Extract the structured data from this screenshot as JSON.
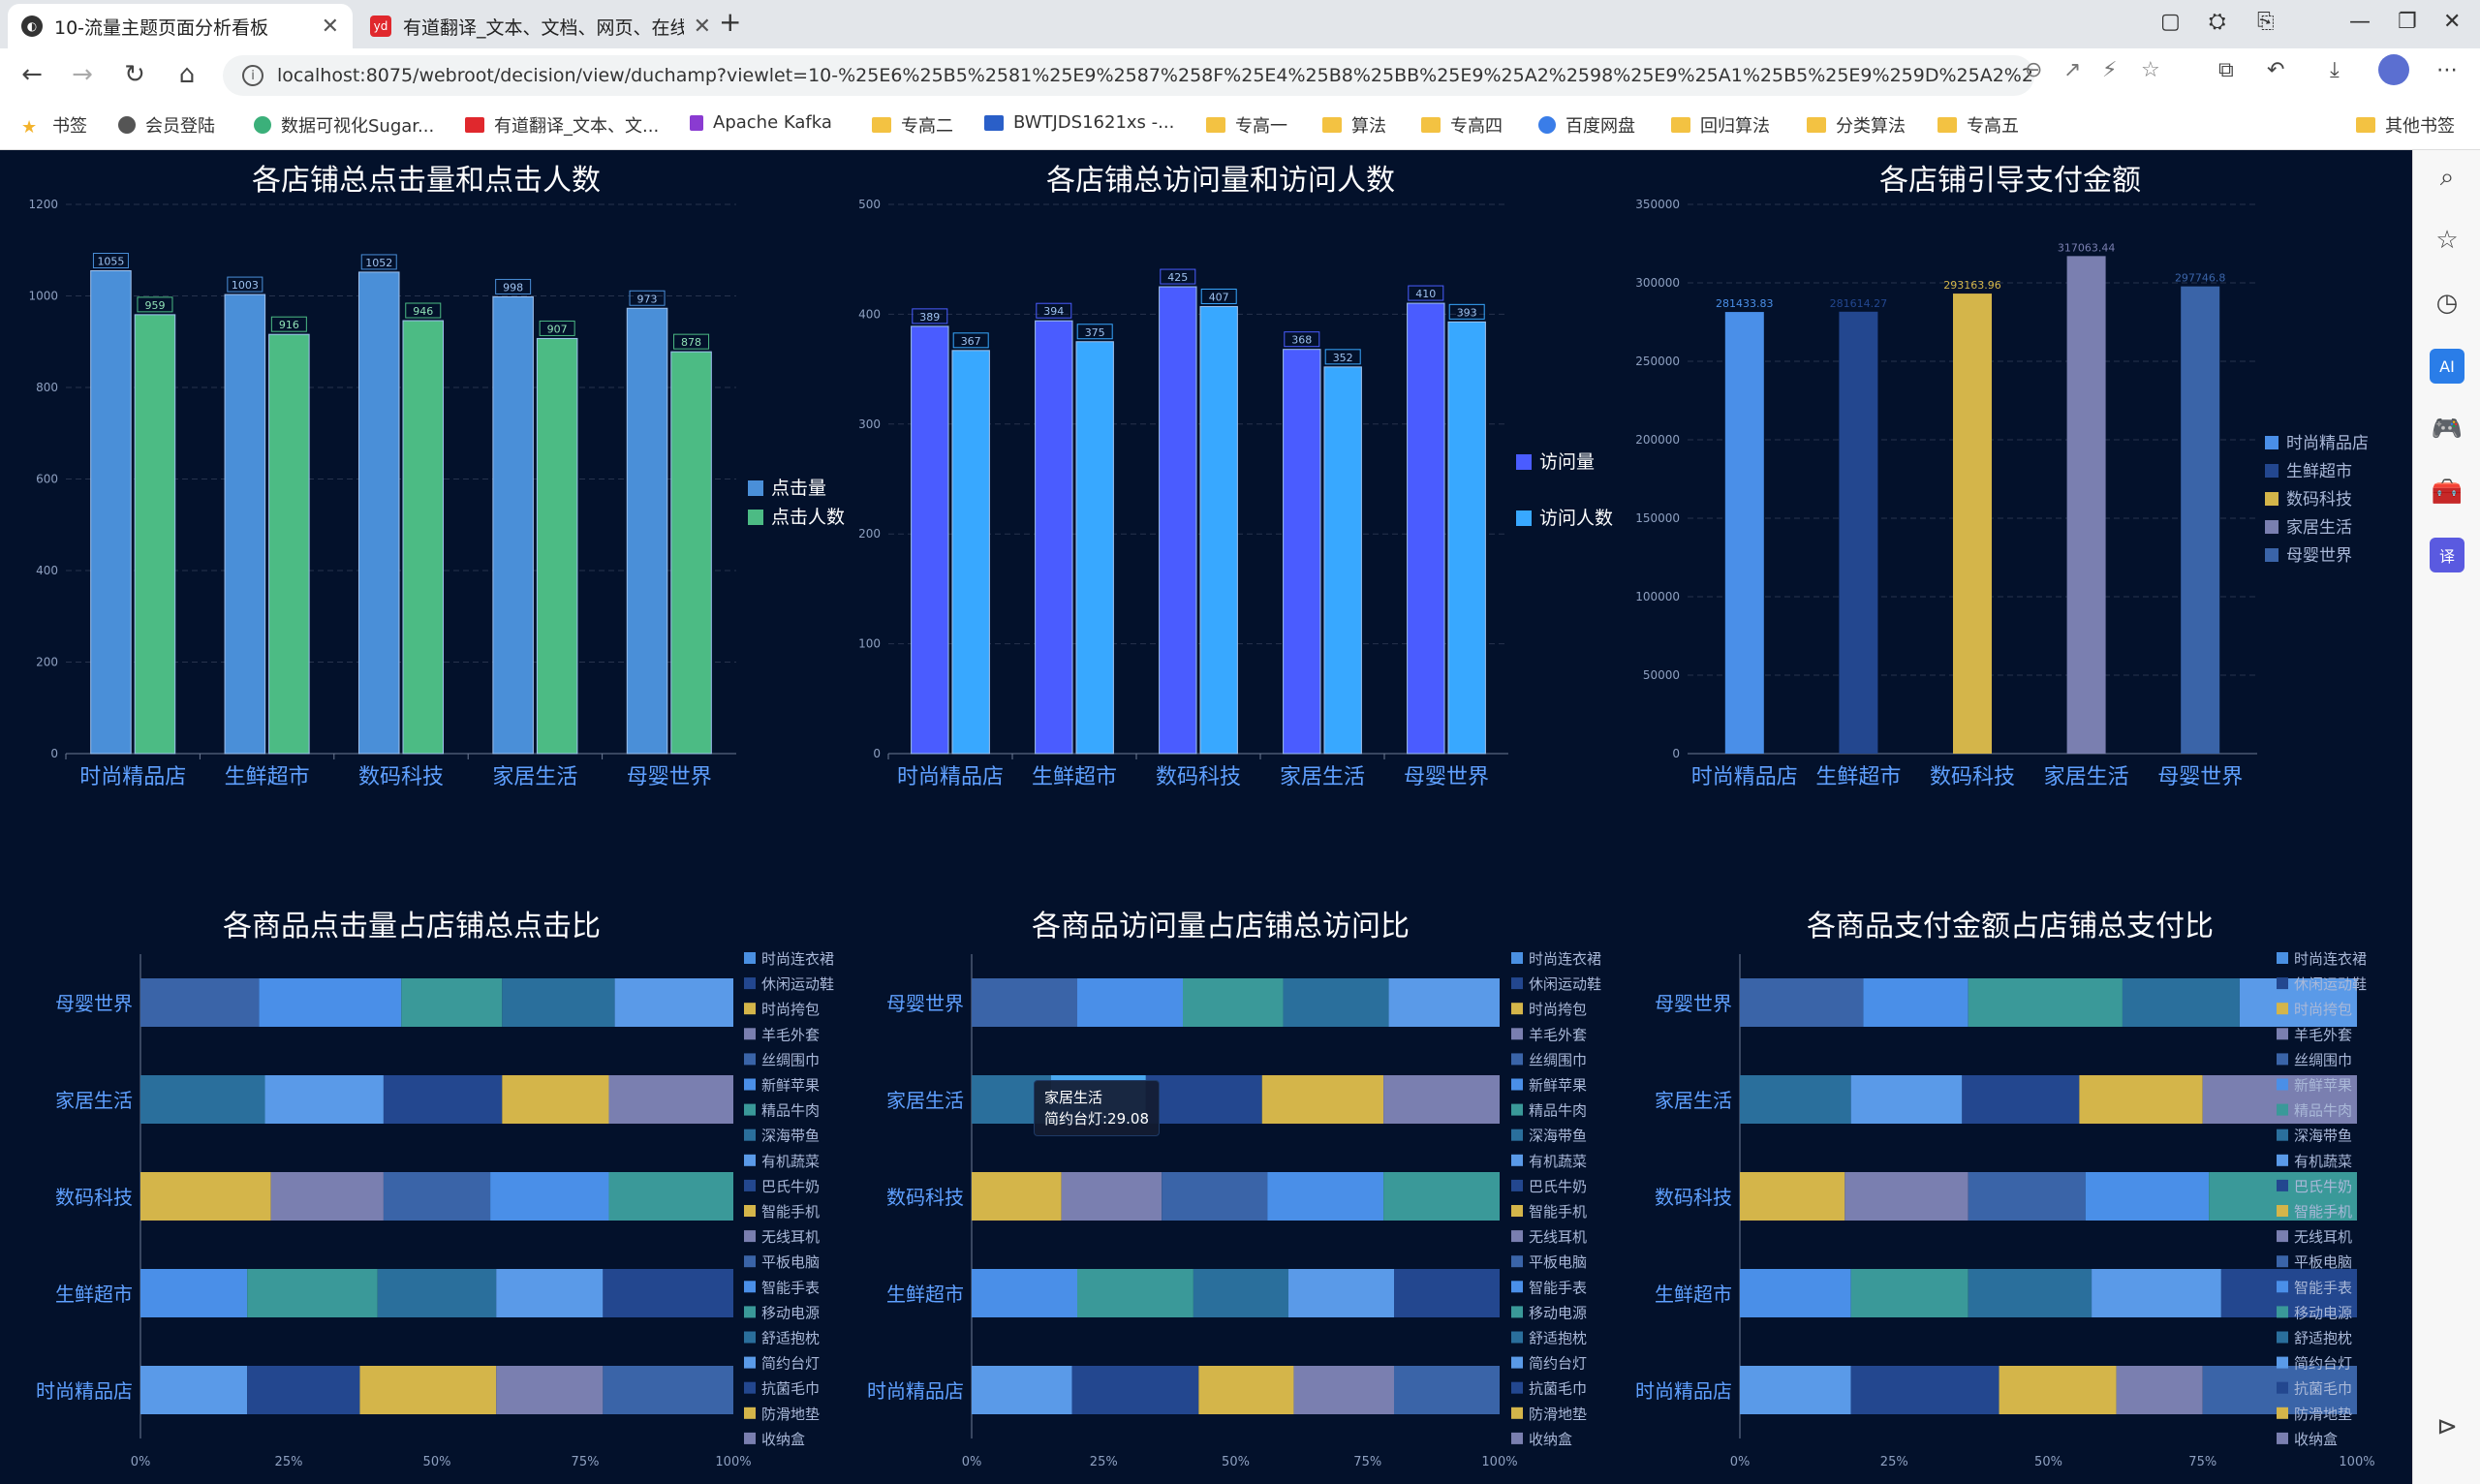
{
  "browser": {
    "tabs": [
      {
        "title": "10-流量主题页面分析看板",
        "close": "✕",
        "active": true
      },
      {
        "title": "有道翻译_文本、文档、网页、在线...",
        "close": "✕",
        "active": false
      }
    ],
    "new_tab": "+",
    "url": "localhost:8075/webroot/decision/view/duchamp?viewlet=10-%25E6%25B5%2581%25E9%2587%258F%25E4%25B8%25BB%25E9%25A2%2598%25E9%25A1%25B5%25E9%259D%25A2%25E5%2588%2586%...",
    "bookmarks": [
      "书签",
      "会员登陆",
      "数据可视化Sugar...",
      "有道翻译_文本、文...",
      "Apache Kafka",
      "专高二",
      "BWTJDS1621xs -...",
      "专高一",
      "算法",
      "专高四",
      "百度网盘",
      "回归算法",
      "分类算法",
      "专高五"
    ],
    "other_bookmarks": "其他书签"
  },
  "colors": {
    "bg": "#03112b",
    "click": "#4a8fd8",
    "clickers": "#4cbb84",
    "visits": "#4a5cff",
    "visitors": "#38a8ff",
    "gridline": "#27334d",
    "axis_text": "#8ea0c0",
    "label_text": "#5fa0ff"
  },
  "charts": {
    "clicks": {
      "title": "各店铺总点击量和点击人数",
      "categories": [
        "时尚精品店",
        "生鲜超市",
        "数码科技",
        "家居生活",
        "母婴世界"
      ],
      "series": [
        {
          "name": "点击量",
          "values": [
            1055,
            1003,
            1052,
            998,
            973
          ]
        },
        {
          "name": "点击人数",
          "values": [
            959,
            916,
            946,
            907,
            878
          ]
        }
      ],
      "ylim": [
        0,
        1200
      ],
      "yticks": [
        0,
        200,
        400,
        600,
        800,
        1000,
        1200
      ]
    },
    "visits": {
      "title": "各店铺总访问量和访问人数",
      "categories": [
        "时尚精品店",
        "生鲜超市",
        "数码科技",
        "家居生活",
        "母婴世界"
      ],
      "series": [
        {
          "name": "访问量",
          "values": [
            389,
            394,
            425,
            368,
            410
          ]
        },
        {
          "name": "访问人数",
          "values": [
            367,
            375,
            407,
            352,
            393
          ]
        }
      ],
      "ylim": [
        0,
        500
      ],
      "yticks": [
        0,
        100,
        200,
        300,
        400,
        500
      ]
    },
    "payment": {
      "title": "各店铺引导支付金额",
      "categories": [
        "时尚精品店",
        "生鲜超市",
        "数码科技",
        "家居生活",
        "母婴世界"
      ],
      "values": [
        281433.83,
        281614.27,
        293163.96,
        317063.44,
        297746.8
      ],
      "value_labels": [
        "281433.83",
        "281614.27",
        "293163.96",
        "317063.44",
        "297746.8"
      ],
      "bar_colors": [
        "#4a8fe8",
        "#23478f",
        "#d4b54a",
        "#7a7fb0",
        "#3a64a8"
      ],
      "ylim": [
        0,
        350000
      ],
      "yticks": [
        0,
        50000,
        100000,
        150000,
        200000,
        250000,
        300000,
        350000
      ],
      "legend": [
        "时尚精品店",
        "生鲜超市",
        "数码科技",
        "家居生活",
        "母婴世界"
      ]
    },
    "stack_legend": [
      "时尚连衣裙",
      "休闲运动鞋",
      "时尚挎包",
      "羊毛外套",
      "丝绸围巾",
      "新鲜苹果",
      "精品牛肉",
      "深海带鱼",
      "有机蔬菜",
      "巴氏牛奶",
      "智能手机",
      "无线耳机",
      "平板电脑",
      "智能手表",
      "移动电源",
      "舒适抱枕",
      "简约台灯",
      "抗菌毛巾",
      "防滑地垫",
      "收纳盒"
    ],
    "stack_legend_colors": [
      "#4a90e2",
      "#23478f",
      "#d4b54a",
      "#7a7fb0",
      "#3a64a8",
      "#4a8fe8",
      "#3a9999",
      "#2a6f9c",
      "#5a9ae8",
      "#23478f",
      "#d4b54a",
      "#7a7fb0",
      "#3a64a8",
      "#4a8fe8",
      "#3a9999",
      "#2a6f9c",
      "#5a9ae8",
      "#23478f",
      "#d4b54a",
      "#7a7fb0"
    ],
    "stacks": [
      {
        "title": "各商品点击量占店铺总点击比",
        "rows": [
          {
            "store": "母婴世界",
            "parts": [
              20,
              24,
              17,
              19,
              20
            ],
            "colors": [
              "#3a64a8",
              "#4a8fe8",
              "#3a9999",
              "#2a6f9c",
              "#5a9ae8"
            ]
          },
          {
            "store": "家居生活",
            "parts": [
              21,
              20,
              20,
              18,
              21
            ],
            "colors": [
              "#2a6f9c",
              "#5a9ae8",
              "#23478f",
              "#d4b54a",
              "#7a7fb0"
            ]
          },
          {
            "store": "数码科技",
            "parts": [
              22,
              19,
              18,
              20,
              21
            ],
            "colors": [
              "#d4b54a",
              "#7a7fb0",
              "#3a64a8",
              "#4a8fe8",
              "#3a9999"
            ]
          },
          {
            "store": "生鲜超市",
            "parts": [
              18,
              22,
              20,
              18,
              22
            ],
            "colors": [
              "#4a8fe8",
              "#3a9999",
              "#2a6f9c",
              "#5a9ae8",
              "#23478f"
            ]
          },
          {
            "store": "时尚精品店",
            "parts": [
              18,
              19,
              23,
              18,
              22
            ],
            "colors": [
              "#5a9ae8",
              "#23478f",
              "#d4b54a",
              "#7a7fb0",
              "#3a64a8"
            ]
          }
        ]
      },
      {
        "title": "各商品访问量占店铺总访问比",
        "rows": [
          {
            "store": "母婴世界",
            "parts": [
              20,
              20,
              19,
              20,
              21
            ],
            "colors": [
              "#3a64a8",
              "#4a8fe8",
              "#3a9999",
              "#2a6f9c",
              "#5a9ae8"
            ]
          },
          {
            "store": "家居生活",
            "parts": [
              15,
              18,
              22,
              23,
              22
            ],
            "colors": [
              "#2a6f9c",
              "#4aa8f0",
              "#23478f",
              "#d4b54a",
              "#7a7fb0"
            ]
          },
          {
            "store": "数码科技",
            "parts": [
              17,
              19,
              20,
              22,
              22
            ],
            "colors": [
              "#d4b54a",
              "#7a7fb0",
              "#3a64a8",
              "#4a8fe8",
              "#3a9999"
            ]
          },
          {
            "store": "生鲜超市",
            "parts": [
              20,
              22,
              18,
              20,
              20
            ],
            "colors": [
              "#4a8fe8",
              "#3a9999",
              "#2a6f9c",
              "#5a9ae8",
              "#23478f"
            ]
          },
          {
            "store": "时尚精品店",
            "parts": [
              19,
              24,
              18,
              19,
              20
            ],
            "colors": [
              "#5a9ae8",
              "#23478f",
              "#d4b54a",
              "#7a7fb0",
              "#3a64a8"
            ]
          }
        ]
      },
      {
        "title": "各商品支付金额占店铺总支付比",
        "rows": [
          {
            "store": "母婴世界",
            "parts": [
              20,
              17,
              25,
              19,
              19
            ],
            "colors": [
              "#3a64a8",
              "#4a8fe8",
              "#3a9999",
              "#2a6f9c",
              "#5a9ae8"
            ]
          },
          {
            "store": "家居生活",
            "parts": [
              18,
              18,
              19,
              20,
              25
            ],
            "colors": [
              "#2a6f9c",
              "#5a9ae8",
              "#23478f",
              "#d4b54a",
              "#7a7fb0"
            ]
          },
          {
            "store": "数码科技",
            "parts": [
              17,
              20,
              19,
              20,
              24
            ],
            "colors": [
              "#d4b54a",
              "#7a7fb0",
              "#3a64a8",
              "#4a8fe8",
              "#3a9999"
            ]
          },
          {
            "store": "生鲜超市",
            "parts": [
              18,
              19,
              20,
              21,
              22
            ],
            "colors": [
              "#4a8fe8",
              "#3a9999",
              "#2a6f9c",
              "#5a9ae8",
              "#23478f"
            ]
          },
          {
            "store": "时尚精品店",
            "parts": [
              18,
              24,
              19,
              14,
              25
            ],
            "colors": [
              "#5a9ae8",
              "#23478f",
              "#d4b54a",
              "#7a7fb0",
              "#3a64a8"
            ]
          }
        ]
      }
    ],
    "stack_xticks": [
      "0%",
      "25%",
      "50%",
      "75%",
      "100%"
    ],
    "tooltip": {
      "line1": "家居生活",
      "line2": "简约台灯:29.08"
    }
  }
}
